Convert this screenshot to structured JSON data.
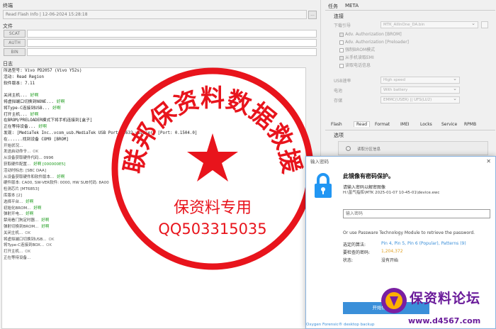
{
  "top": {
    "section_label": "终端",
    "device_combo": "Read Flash Info | 12-06-2024 15:28:18",
    "browse_label": "...",
    "file_section": "文件",
    "file_buttons": [
      "SCAT",
      "AUTH",
      "BIN"
    ],
    "log_section": "日志"
  },
  "log": [
    {
      "text": "所选型号: Vivo PD2057 (Vivo Y52s)",
      "ok": "",
      "style": "mono"
    },
    {
      "text": "活动: Read Region",
      "ok": "",
      "style": "mono"
    },
    {
      "text": "软件版本: 7.11",
      "ok": "",
      "style": "mono"
    },
    {
      "text": "",
      "ok": "",
      "style": "mono"
    },
    {
      "text": "关闭主机...",
      "ok": "好啊",
      "style": "mono"
    },
    {
      "text": "将虚拟端口切换到NONE...",
      "ok": "好啊",
      "style": "mono"
    },
    {
      "text": "将Type-C连接到USB...",
      "ok": "好啊",
      "style": "mono"
    },
    {
      "text": "打开主机...",
      "ok": "好啊",
      "style": "mono"
    },
    {
      "text": "在BROM/PRELOADER模式下将手机连接到[盒子]",
      "ok": "",
      "style": "mono"
    },
    {
      "text": "正在等待设备...",
      "ok": "好啊",
      "style": "mono"
    },
    {
      "text": "发现: [MediaTek Inc..vcom_usb.MediaTek USB Port_V1632.usb2ser] [Port: 0.1504.0]",
      "ok": "",
      "style": "mono"
    },
    {
      "text": "在......找到设备 COM9 [BROM]",
      "ok": "",
      "style": "mono"
    },
    {
      "text": "开始状况...",
      "ok": "",
      "style": "sans"
    },
    {
      "text": "发送启动命令...",
      "ok": "OK",
      "style": "sans"
    },
    {
      "text": "从设备获取硬件代码... 0996",
      "ok": "",
      "style": "sans"
    },
    {
      "text": "获取硬件配置...",
      "ok": "好啊 [000000E5]",
      "style": "sans"
    },
    {
      "text": "活动时标志: [SBC DAA]",
      "ok": "",
      "style": "sans"
    },
    {
      "text": "从设备获取硬件和软件版本...",
      "ok": "好啊",
      "style": "sans"
    },
    {
      "text": "硬件版本: CA00, SW-VER软件: 0000, HW SUB代码: 8A00",
      "ok": "",
      "style": "sans"
    },
    {
      "text": "检测芯片 [MT6853]",
      "ok": "",
      "style": "sans"
    },
    {
      "text": "库版本 [2]",
      "ok": "",
      "style": "sans"
    },
    {
      "text": "选择平台...",
      "ok": "好啊",
      "style": "sans"
    },
    {
      "text": "初始化BROM...",
      "ok": "好啊",
      "style": "sans"
    },
    {
      "text": "弹射开电...",
      "ok": "好啊",
      "style": "sans"
    },
    {
      "text": "禁用看门狗定时器...",
      "ok": "好啊",
      "style": "sans"
    },
    {
      "text": "弹射切换到BROM...",
      "ok": "好啊",
      "style": "sans"
    },
    {
      "text": "关闭主机...",
      "ok": "OK",
      "style": "sans"
    },
    {
      "text": "将虚拟端口切换到USB...",
      "ok": "OK",
      "style": "sans"
    },
    {
      "text": "将Type-C连接到BOX...",
      "ok": "OK",
      "style": "sans"
    },
    {
      "text": "打开主机...",
      "ok": "OK",
      "style": "sans"
    },
    {
      "text": "正在等待设备...",
      "ok": "",
      "style": "sans"
    }
  ],
  "right": {
    "tabs": [
      "任务",
      "META"
    ],
    "connect_label": "连接",
    "download_label": "下载引导",
    "download_value": "MTK_AllInOne_DA.bin",
    "checks": [
      {
        "label": "Adv. Authorization [BROM]",
        "on": true
      },
      {
        "label": "Adv. Authorization [Preloader]",
        "on": false
      },
      {
        "label": "强制BROM模式",
        "on": false
      },
      {
        "label": "从手机读取EMI",
        "on": true
      },
      {
        "label": "读取电话信息",
        "on": false
      }
    ],
    "usb_label": "USB速率",
    "usb_value": "High speed",
    "power_label": "电池",
    "power_value": "With battery",
    "storage_label": "存储",
    "storage_value": "EMMC(USER) || UFS(LU2)",
    "bottom_tabs": [
      "Flash",
      "Read",
      "Format",
      "IMEI",
      "Locks",
      "Service",
      "RPMB"
    ],
    "options_label": "选项",
    "read_info_label": "读取分区信息"
  },
  "dialog": {
    "title": "输入密码",
    "close": "✕",
    "heading": "此镜像有密码保护。",
    "line1": "请输入密码以解密图像",
    "line2": "H:\\氢气指挥\\MTK 2025-01-07 10-45-01\\device.ewc",
    "password_placeholder": "输入密码",
    "or_text": "Or use Passware Technology Module to retrieve the password.",
    "algo_label": "选定的算法:",
    "algo_value": "Pin 4, Pin 5, Pin 6 (Popular), Patterns (9)",
    "checked_label": "要检查的密码:",
    "checked_value": "1,204,372",
    "status_label": "状态:",
    "status_value": "没有开始",
    "start_button": "开始恢复密码"
  },
  "bottom_link": "Oxygen Forensic® desktop backup",
  "stamp": {
    "arc_text": "联邦保资料数据救援",
    "center_text": "保资料专用",
    "qq_text": "QQ503315035"
  },
  "watermark": {
    "title": "保资料论坛",
    "url": "www.d4567.com"
  },
  "colors": {
    "stamp_red": "#e8141c",
    "ok_green": "#1a9a1a",
    "accent_blue": "#3a8fd9",
    "lock_blue": "#2196f3"
  }
}
